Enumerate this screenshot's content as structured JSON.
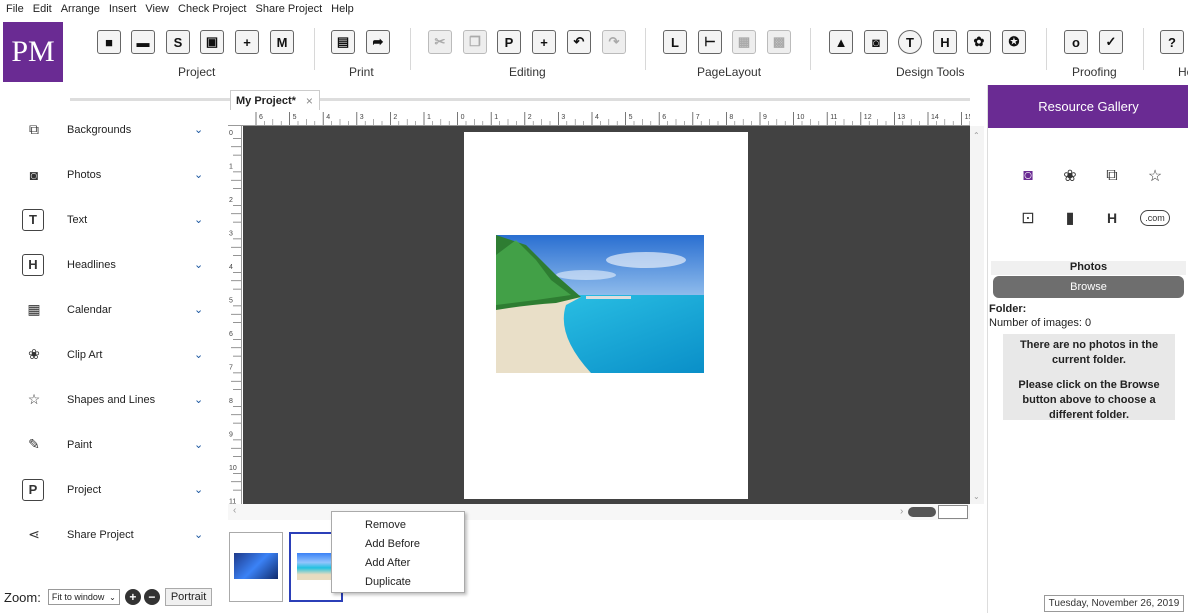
{
  "menu": [
    "File",
    "Edit",
    "Arrange",
    "Insert",
    "View",
    "Check Project",
    "Share Project",
    "Help"
  ],
  "logo": "PM",
  "toolbar_groups": [
    {
      "label": "Project"
    },
    {
      "label": "Print"
    },
    {
      "label": "Editing"
    },
    {
      "label": "PageLayout"
    },
    {
      "label": "Design Tools"
    },
    {
      "label": "Proofing"
    },
    {
      "label": "He"
    }
  ],
  "sidebar": {
    "items": [
      {
        "label": "Backgrounds",
        "icon": "backgrounds-icon"
      },
      {
        "label": "Photos",
        "icon": "camera-icon"
      },
      {
        "label": "Text",
        "icon": "text-icon"
      },
      {
        "label": "Headlines",
        "icon": "headline-icon"
      },
      {
        "label": "Calendar",
        "icon": "calendar-icon"
      },
      {
        "label": "Clip Art",
        "icon": "lotus-icon"
      },
      {
        "label": "Shapes and Lines",
        "icon": "star-icon"
      },
      {
        "label": "Paint",
        "icon": "brush-icon"
      },
      {
        "label": "Project",
        "icon": "project-icon"
      },
      {
        "label": "Share Project",
        "icon": "share-icon"
      }
    ]
  },
  "zoom": {
    "label": "Zoom:",
    "value": "Fit to window",
    "orientation": "Portrait"
  },
  "tab": {
    "title": "My Project*"
  },
  "ruler_top": [
    "6",
    "5",
    "4",
    "3",
    "2",
    "1",
    "0",
    "1",
    "2",
    "3",
    "4",
    "5",
    "6",
    "7",
    "8",
    "9",
    "10",
    "11",
    "12",
    "13",
    "14",
    "15"
  ],
  "ruler_left": [
    "0",
    "1",
    "2",
    "3",
    "4",
    "5",
    "6",
    "7",
    "8",
    "9",
    "10",
    "11"
  ],
  "context_menu": [
    "Remove",
    "Add Before",
    "Add After",
    "Duplicate"
  ],
  "resource_gallery": {
    "title": "Resource Gallery",
    "photos_header": "Photos",
    "browse": "Browse",
    "folder_label": "Folder:",
    "num_images": "Number of images: 0",
    "msg1": "There are no photos in the current folder.",
    "msg2": "Please click on the Browse button above to choose a different folder.",
    "com_icon_label": ".com"
  },
  "status": {
    "date": "Tuesday, November 26, 2019"
  },
  "colors": {
    "brand": "#6a2b93",
    "canvas": "#424242"
  }
}
